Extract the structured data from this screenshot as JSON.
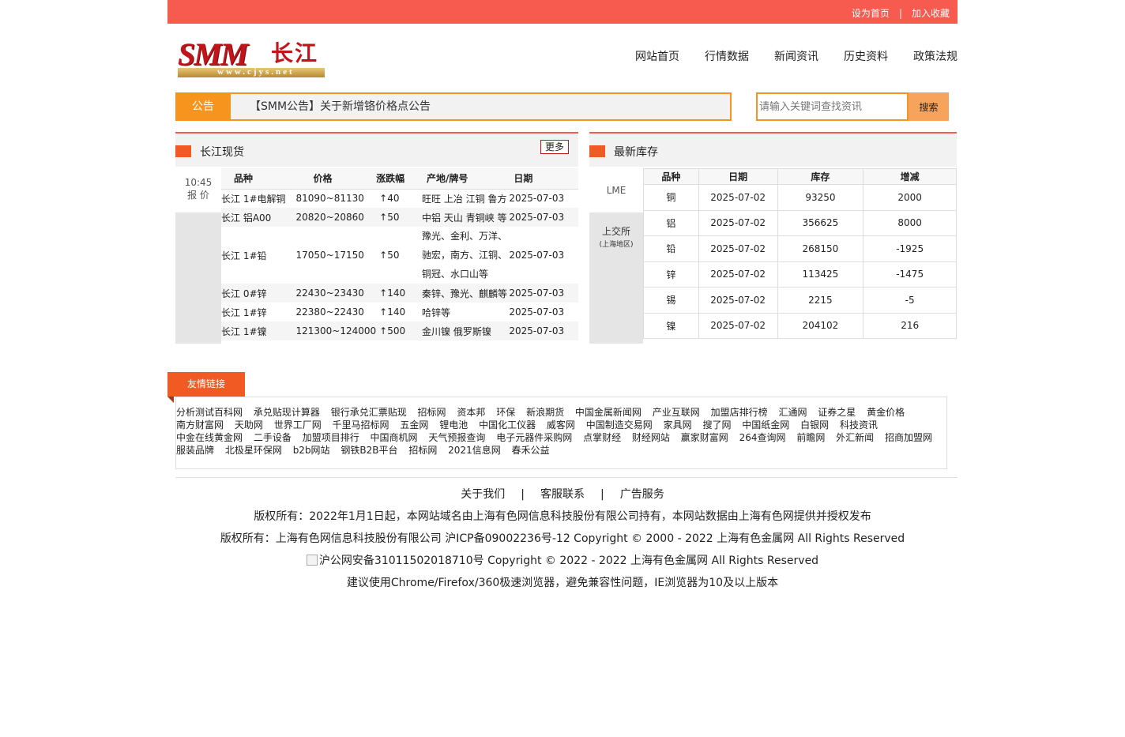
{
  "topbar": {
    "set_home": "设为首页",
    "separator": "|",
    "add_favorite": "加入收藏"
  },
  "logo": {
    "smm": "SMM",
    "cj": "长江",
    "url": "www.cjys.net"
  },
  "nav": [
    "网站首页",
    "行情数据",
    "新闻资讯",
    "历史资料",
    "政策法规"
  ],
  "notice": {
    "label": "公告",
    "text": "【SMM公告】关于新增铬价格点公告"
  },
  "search": {
    "placeholder": "请输入关键词查找资讯",
    "button": "搜索"
  },
  "spot": {
    "title": "长江现货",
    "more": "更多",
    "time": "10:45",
    "time_label": "报 价",
    "headers": [
      "品种",
      "价格",
      "涨跌幅",
      "产地/牌号",
      "日期"
    ],
    "rows": [
      [
        "长江 1#电解铜",
        "81090~81130",
        "↑40",
        "旺旺 上冶 江铜 鲁方",
        "2025-07-03"
      ],
      [
        "长江 铝A00",
        "20820~20860",
        "↑50",
        "中铝 天山 青铜峡 等",
        "2025-07-03"
      ],
      [
        "长江 1#铅",
        "17050~17150",
        "↑50",
        "豫光、金利、万洋、驰宏，南方、江铜、铜冠、水口山等",
        "2025-07-03"
      ],
      [
        "长江 0#锌",
        "22430~23430",
        "↑140",
        "秦锌、豫光、麒麟等",
        "2025-07-03"
      ],
      [
        "长江 1#锌",
        "22380~22430",
        "↑140",
        "哈锌等",
        "2025-07-03"
      ],
      [
        "长江 1#镍",
        "121300~124000",
        "↑500",
        "金川镍 俄罗斯镍",
        "2025-07-03"
      ]
    ],
    "lead_brand_lines": [
      "豫光、金利、万洋、",
      "驰宏，南方、江铜、",
      "铜冠、水口山等"
    ]
  },
  "inventory": {
    "title": "最新库存",
    "lme": "LME",
    "shfe": "上交所",
    "shfe_sub": "(上海地区)",
    "headers": [
      "品种",
      "日期",
      "库存",
      "增减"
    ],
    "rows": [
      [
        "铜",
        "2025-07-02",
        "93250",
        "2000"
      ],
      [
        "铝",
        "2025-07-02",
        "356625",
        "8000"
      ],
      [
        "铅",
        "2025-07-02",
        "268150",
        "-1925"
      ],
      [
        "锌",
        "2025-07-02",
        "113425",
        "-1475"
      ],
      [
        "锡",
        "2025-07-02",
        "2215",
        "-5"
      ],
      [
        "镍",
        "2025-07-02",
        "204102",
        "216"
      ]
    ]
  },
  "friend_links": {
    "title": "友情链接",
    "links": [
      "分析测试百科网",
      "承兑贴现计算器",
      "银行承兑汇票贴现",
      "招标网",
      "资本邦",
      "环保",
      "新浪期货",
      "中国金属新闻网",
      "产业互联网",
      "加盟店排行榜",
      "汇通网",
      "证券之星",
      "黄金价格",
      "南方财富网",
      "天助网",
      "世界工厂网",
      "千里马招标网",
      "五金网",
      "锂电池",
      "中国化工仪器",
      "威客网",
      "中国制造交易网",
      "家具网",
      "搜了网",
      "中国纸金网",
      "白银网",
      "科技资讯",
      "中金在线黄金网",
      "二手设备",
      "加盟项目排行",
      "中国商机网",
      "天气预报查询",
      "电子元器件采购网",
      "点掌财经",
      "财经网站",
      "赢家财富网",
      "264查询网",
      "前瞻网",
      "外汇新闻",
      "招商加盟网",
      "服装品牌",
      "北极星环保网",
      "b2b网站",
      "钢铁B2B平台",
      "招标网",
      "2021信息网",
      "春禾公益"
    ]
  },
  "footer": {
    "links": [
      "关于我们",
      "客服联系",
      "广告服务"
    ],
    "separator": "|",
    "line1": "版权所有：2022年1月1日起，本网站域名由上海有色网信息科技股份有限公司持有，本网站数据由上海有色网提供并授权发布",
    "line2": "版权所有：上海有色网信息科技股份有限公司 沪ICP备09002236号-12 Copyright © 2000 - 2022 上海有色金属网 All Rights Reserved",
    "line3": "沪公网安备31011502018710号 Copyright © 2022 - 2022 上海有色金属网 All Rights Reserved",
    "line4": "建议使用Chrome/Firefox/360极速浏览器，避免兼容性问题，IE浏览器为10及以上版本"
  }
}
